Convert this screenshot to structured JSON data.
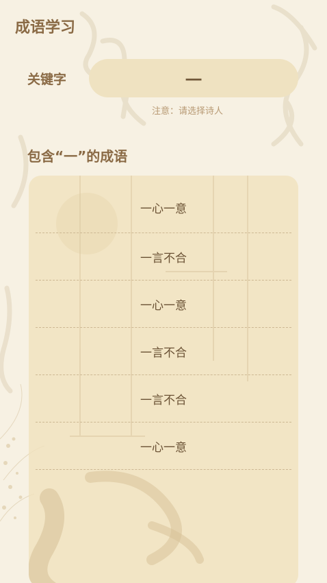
{
  "header": {
    "title": "成语学习"
  },
  "search": {
    "label": "关键字",
    "value": "一",
    "hint": "注意：请选择诗人"
  },
  "results": {
    "title": "包含“一”的成语",
    "items": [
      "一心一意",
      "一言不合",
      "一心一意",
      "一言不合",
      "一言不合",
      "一心一意"
    ]
  },
  "colors": {
    "background": "#f7f1e3",
    "accent_text": "#8a6a45",
    "field_bg": "#efe2c1",
    "card_bg": "#f0e2be"
  }
}
